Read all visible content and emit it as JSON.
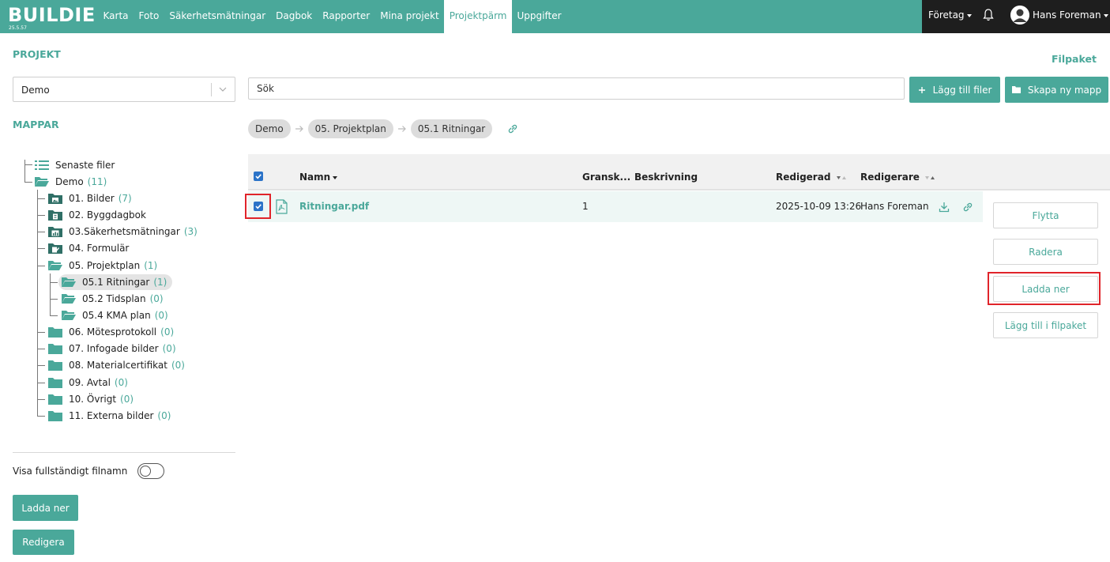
{
  "app": {
    "logo": "BUILDIE",
    "version": "25.5.57"
  },
  "nav": [
    "Karta",
    "Foto",
    "Säkerhetsmätningar",
    "Dagbok",
    "Rapporter",
    "Mina projekt",
    "Projektpärm",
    "Uppgifter"
  ],
  "nav_active": "Projektpärm",
  "topright": {
    "company": "Företag",
    "user": "Hans Foreman"
  },
  "sidebar": {
    "project_title": "PROJEKT",
    "project_value": "Demo",
    "folders_title": "MAPPAR",
    "tree": [
      {
        "label": "Senaste filer",
        "count": "",
        "icon": "list-icon"
      },
      {
        "label": "Demo",
        "count": "(11)",
        "icon": "folder-open-icon"
      },
      {
        "label": "01. Bilder",
        "count": "(7)",
        "icon": "folder-image-icon"
      },
      {
        "label": "02. Byggdagbok",
        "count": "",
        "icon": "folder-book-icon"
      },
      {
        "label": "03.Säkerhetsmätningar",
        "count": "(3)",
        "icon": "folder-chart-icon"
      },
      {
        "label": "04. Formulär",
        "count": "",
        "icon": "folder-form-icon"
      },
      {
        "label": "05. Projektplan",
        "count": "(1)",
        "icon": "folder-open-icon"
      },
      {
        "label": "05.1 Ritningar",
        "count": "(1)",
        "icon": "folder-open-icon"
      },
      {
        "label": "05.2 Tidsplan",
        "count": "(0)",
        "icon": "folder-open-icon"
      },
      {
        "label": "05.4 KMA plan",
        "count": "(0)",
        "icon": "folder-open-icon"
      },
      {
        "label": "06. Mötesprotokoll",
        "count": "(0)",
        "icon": "folder-icon"
      },
      {
        "label": "07. Infogade bilder",
        "count": "(0)",
        "icon": "folder-icon"
      },
      {
        "label": "08. Materialcertifikat",
        "count": "(0)",
        "icon": "folder-icon"
      },
      {
        "label": "09. Avtal",
        "count": "(0)",
        "icon": "folder-icon"
      },
      {
        "label": "10. Övrigt",
        "count": "(0)",
        "icon": "folder-icon"
      },
      {
        "label": "11. Externa bilder",
        "count": "(0)",
        "icon": "folder-icon"
      }
    ],
    "toggle_label": "Visa fullständigt filnamn",
    "download_label": "Ladda ner",
    "edit_label": "Redigera"
  },
  "main": {
    "search_placeholder": "Sök",
    "filpaket_label": "Filpaket",
    "add_files_label": "Lägg till filer",
    "new_folder_label": "Skapa ny mapp",
    "breadcrumb": [
      "Demo",
      "05. Projektplan",
      "05.1 Ritningar"
    ],
    "columns": {
      "name": "Namn",
      "review": "Gransk...",
      "description": "Beskrivning",
      "edited": "Redigerad",
      "editor": "Redigerare"
    },
    "rows": [
      {
        "name": "Ritningar.pdf",
        "review": "1",
        "description": "",
        "edited": "2025-10-09 13:26",
        "editor": "Hans Foreman"
      }
    ],
    "actions": {
      "move": "Flytta",
      "delete": "Radera",
      "download": "Ladda ner",
      "add_to_package": "Lägg till i filpaket"
    }
  },
  "colors": {
    "accent": "#4aa89a",
    "highlight": "#e0242a",
    "checkbox": "#2b73c8"
  }
}
